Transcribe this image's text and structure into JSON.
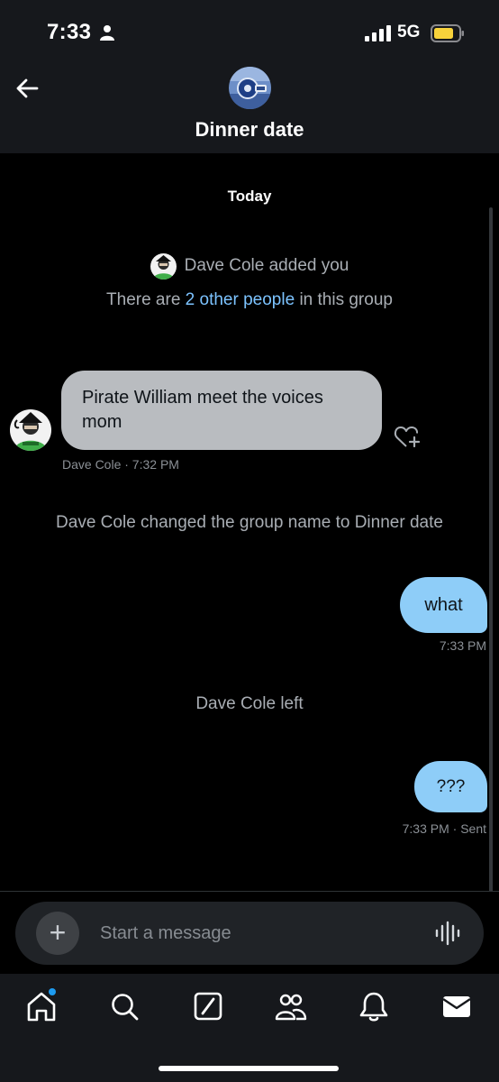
{
  "status_bar": {
    "time": "7:33",
    "network": "5G",
    "icons": [
      "person-icon",
      "signal-icon",
      "battery-icon"
    ]
  },
  "header": {
    "title": "Dinner date",
    "back_icon": "arrow-left-icon"
  },
  "chat": {
    "date_separator": "Today",
    "system": {
      "added_text": "Dave Cole added you",
      "others_prefix": "There are ",
      "others_link": "2 other people",
      "others_suffix": " in this group",
      "name_change": "Dave Cole changed the group name to Dinner date",
      "left": "Dave Cole left"
    },
    "messages": [
      {
        "direction": "incoming",
        "text": "Pirate William meet the voices mom",
        "meta": "Dave Cole · 7:32 PM"
      },
      {
        "direction": "outgoing",
        "text": "what",
        "meta": "7:33 PM"
      },
      {
        "direction": "outgoing",
        "text": "???",
        "meta": "7:33 PM · Sent"
      }
    ]
  },
  "composer": {
    "placeholder": "Start a message",
    "add_icon": "+"
  },
  "bottom_nav": {
    "items": [
      "home-icon",
      "search-icon",
      "grok-icon",
      "communities-icon",
      "notifications-icon",
      "messages-icon"
    ],
    "active": "messages-icon",
    "badge_on": "home-icon"
  },
  "colors": {
    "background": "#000000",
    "bar": "#16181c",
    "incoming_bubble": "#b9bcc0",
    "outgoing_bubble": "#8ecdf8",
    "link": "#7cc3ff",
    "badge": "#1d9bf0"
  }
}
